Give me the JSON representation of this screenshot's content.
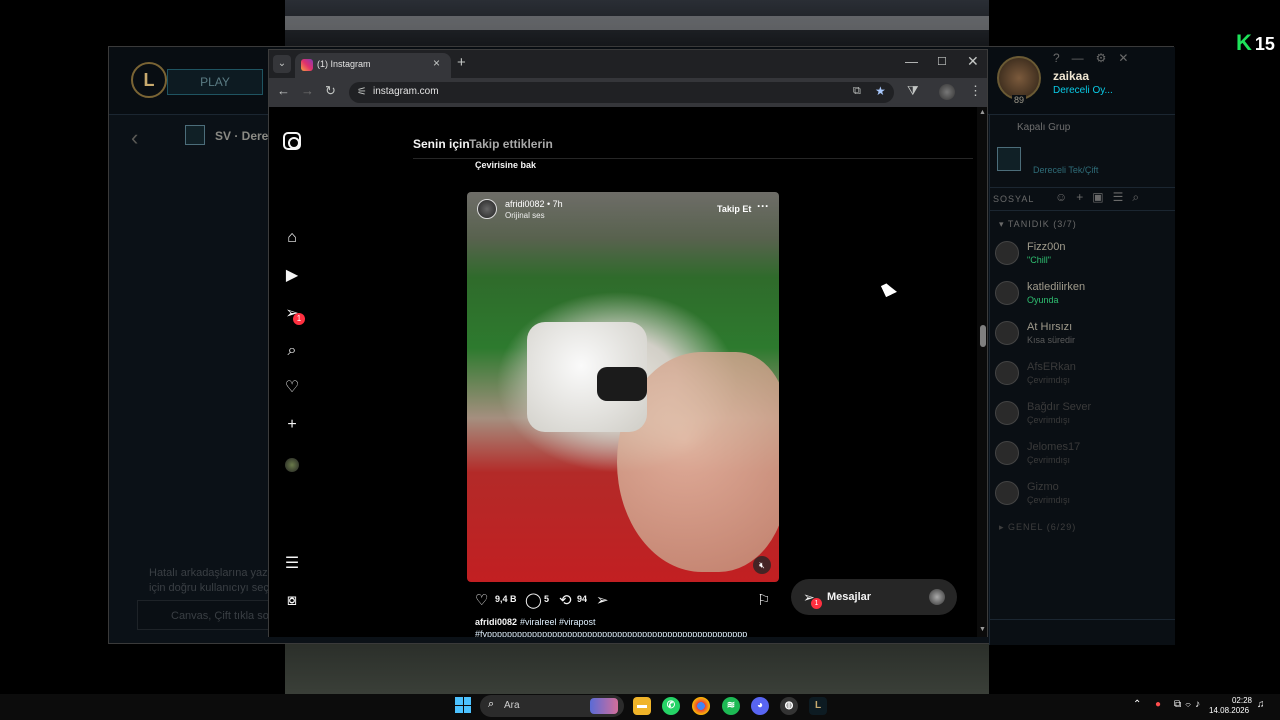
{
  "overlay": {
    "badge_letter": "K",
    "badge_number": "15"
  },
  "league": {
    "play_button": "PLAY",
    "queue_title": "SV · Dere",
    "chat_line1": "Hatalı arkadaşlarına yazmak",
    "chat_line2": "için doğru kullanıcıyı seç...",
    "chat_placeholder": "Canvas, Çift tıkla sohbete başla",
    "user": {
      "name": "zaikaa",
      "status": "Dereceli Oy...",
      "level": "89"
    },
    "group_title": "Kapalı Grup",
    "group_sub": "Dereceli Tek/Çift",
    "social_label": "SOSYAL",
    "friends_header": "▾ TANIDIK (3/7)",
    "general_header": "▸ GENEL (6/29)",
    "friends": [
      {
        "name": "Fizz00n",
        "status": "\"Chill\"",
        "offline": false
      },
      {
        "name": "katledilirken",
        "status": "Oyunda",
        "offline": false
      },
      {
        "name": "At Hırsızı",
        "status": "Kısa süredir",
        "offline": false
      },
      {
        "name": "AfsERkan",
        "status": "Çevrimdışı",
        "offline": true
      },
      {
        "name": "Bağdır Sever",
        "status": "Çevrimdışı",
        "offline": true
      },
      {
        "name": "Jelomes17",
        "status": "Çevrimdışı",
        "offline": true
      },
      {
        "name": "Gizmo",
        "status": "Çevrimdışı",
        "offline": true
      }
    ]
  },
  "browser": {
    "tab_title": "(1) Instagram",
    "url": "instagram.com",
    "window_controls": {
      "minimize": "—",
      "maximize": "☐",
      "close": "✕"
    }
  },
  "instagram": {
    "nav_dm_badge": "1",
    "feed_tabs": {
      "for_you": "Senin için",
      "following": "Takip ettiklerin"
    },
    "see_translation": "Çevirisine bak",
    "post": {
      "username": "afridi0082",
      "time": "afridi0082 • 7h",
      "audio": "Orijinal ses",
      "follow": "Takip Et",
      "more": "···",
      "likes": "9,4 B",
      "comments": "5",
      "reposts": "94",
      "caption_user": "afridi0082",
      "caption_tags": "#viralreel #virapost",
      "caption_more": "#fypppppppppppppppppppppppppppppppppppppppppppppppppppp"
    },
    "messages": {
      "label": "Mesajlar",
      "badge": "1"
    }
  },
  "taskbar": {
    "search_placeholder": "Ara",
    "time": "02:28",
    "date": "14.08.2026"
  }
}
